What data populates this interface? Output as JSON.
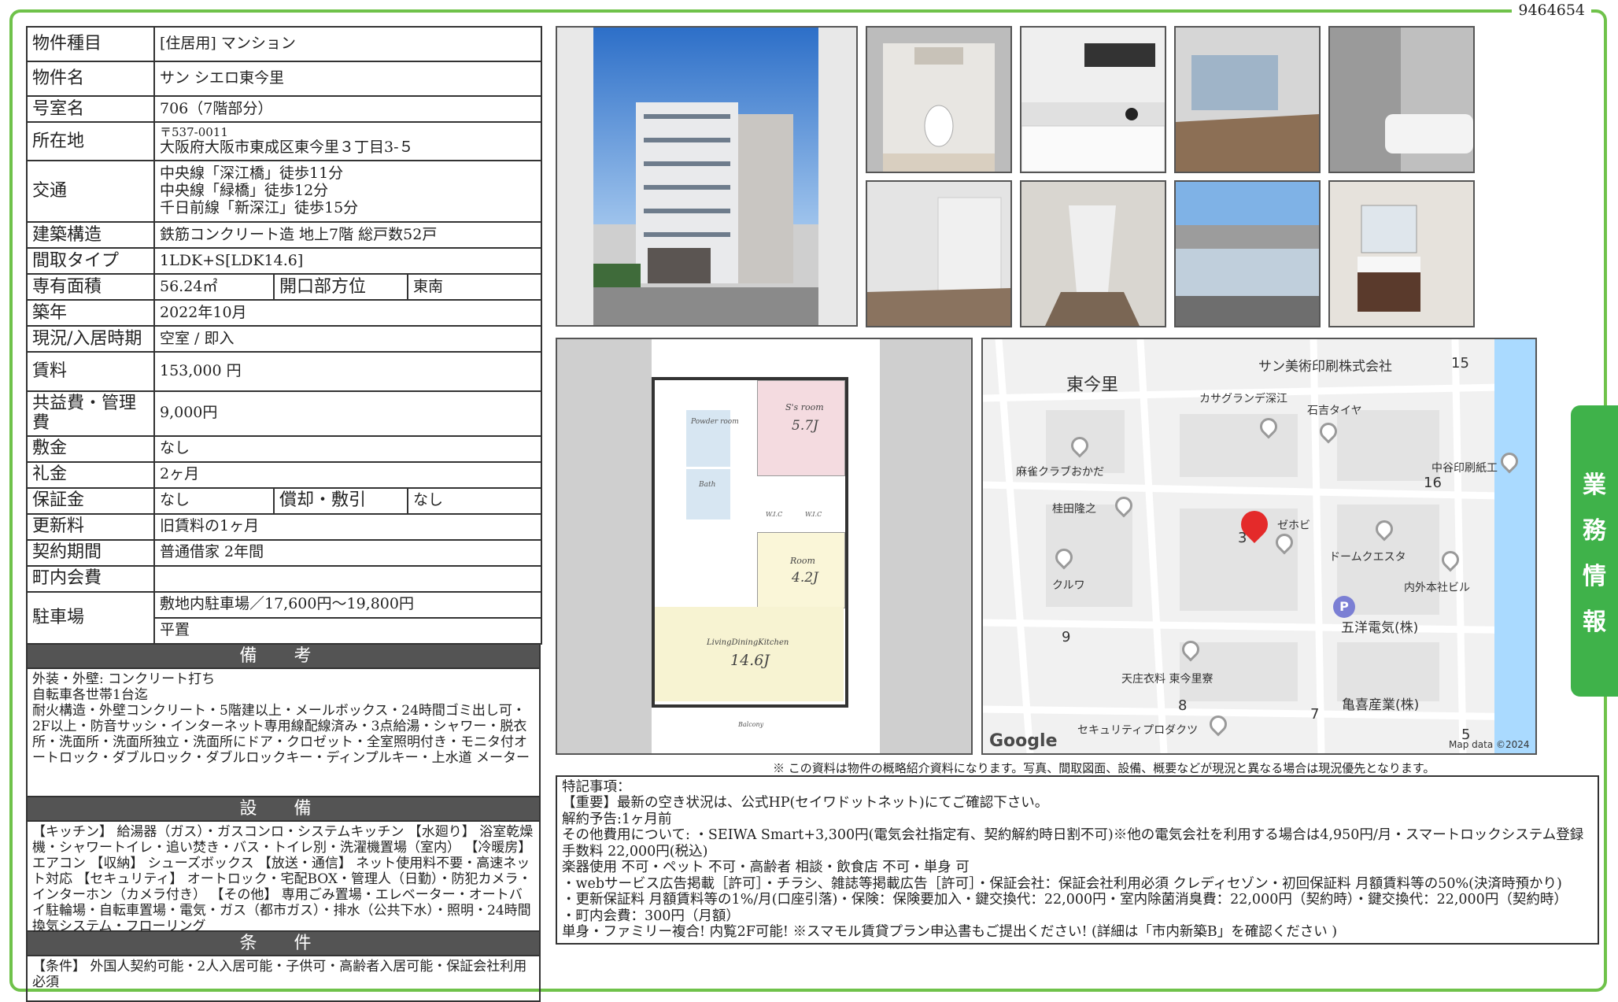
{
  "doc_no": "9464654",
  "spec": {
    "type_label": "物件種目",
    "type_value": "[住居用] マンション",
    "name_label": "物件名",
    "name_value": "サン シエロ東今里",
    "room_label": "号室名",
    "room_value": "706（7階部分）",
    "addr_label": "所在地",
    "zip": "〒537-0011",
    "addr_value": "大阪府大阪市東成区東今里３丁目3-５",
    "access_label": "交通",
    "access1": "中央線「深江橋」徒歩11分",
    "access2": "中央線「緑橋」徒歩12分",
    "access3": "千日前線「新深江」徒歩15分",
    "structure_label": "建築構造",
    "structure_value": "鉄筋コンクリート造 地上7階 総戸数52戸",
    "layout_label": "間取タイプ",
    "layout_value": "1LDK+S[LDK14.6]",
    "area_label": "専有面積",
    "area_value": "56.24㎡",
    "facing_label": "開口部方位",
    "facing_value": "東南",
    "built_label": "築年",
    "built_value": "2022年10月",
    "status_label": "現況/入居時期",
    "status_value": "空室 / 即入",
    "rent_label": "賃料",
    "rent_value": "153,000 円",
    "fee_label": "共益費・管理費",
    "fee_value": "9,000円",
    "deposit_label": "敷金",
    "deposit_value": "なし",
    "key_label": "礼金",
    "key_value": "2ヶ月",
    "guarantee_label": "保証金",
    "guarantee_value": "なし",
    "amort_label": "償却・敷引",
    "amort_value": "なし",
    "renew_label": "更新料",
    "renew_value": "旧賃料の1ヶ月",
    "contract_label": "契約期間",
    "contract_value": "普通借家 2年間",
    "town_label": "町内会費",
    "town_value": "",
    "parking_label": "駐車場",
    "parking1": "敷地内駐車場／17,600円～19,800円",
    "parking2": "平置"
  },
  "sections": {
    "remarks_title": "備 考",
    "remarks_text": "外装・外壁: コンクリート打ち\n自転車各世帯1台迄\n耐火構造・外壁コンクリート・5階建以上・メールボックス・24時間ゴミ出し可・2F以上・防音サッシ・インターネット専用線配線済み・3点給湯・シャワー・脱衣所・洗面所・洗面所独立・洗面所にドア・クロゼット・全室照明付き・モニタ付オートロック・ダブルロック・ダブルロックキー・ディンプルキー・上水道 メーター",
    "equip_title": "設 備",
    "equip_text": "【キッチン】 給湯器（ガス）・ガスコンロ・システムキッチン 【水廻り】 浴室乾燥機・シャワートイレ・追い焚き・バス・トイレ別・洗濯機置場（室内） 【冷暖房】 エアコン 【収納】 シューズボックス 【放送・通信】 ネット使用料不要・高速ネット対応 【セキュリティ】 オートロック・宅配BOX・管理人（日勤）・防犯カメラ・インターホン（カメラ付き） 【その他】 専用ごみ置場・エレベーター・オートバイ駐輪場・自転車置場・電気・ガス（都市ガス）・排水（公共下水）・照明・24時間換気システム・フローリング",
    "cond_title": "条 件",
    "cond_text": "【条件】 外国人契約可能・2人入居可能・子供可・高齢者入居可能・保証会社利用必須"
  },
  "floorplan": {
    "powder": "Powder room",
    "bath": "Bath",
    "sroom": "S's room",
    "sroom_size": "5.7J",
    "wic1": "W.I.C",
    "wic2": "W.I.C",
    "room": "Room",
    "room_size": "4.2J",
    "ldk": "LivingDiningKitchen",
    "ldk_size": "14.6J",
    "balcony": "Balcony"
  },
  "map": {
    "area": "東今里",
    "labels": [
      "サン美術印刷株式会社",
      "カサグランデ深江",
      "石吉タイヤ",
      "麻雀クラブおかだ",
      "中谷印刷紙工",
      "桂田隆之",
      "ゼホビ",
      "ドームクエスタ",
      "クルワ",
      "内外本社ビル",
      "五洋電気(株)",
      "天庄衣料 東今里寮",
      "亀喜産業(株)",
      "セキュリティプロダクツ"
    ],
    "numbers": [
      "15",
      "16",
      "3",
      "9",
      "8",
      "7",
      "5"
    ],
    "google": "Google",
    "copyright": "Map data ©2024"
  },
  "side_tab": [
    "業",
    "務",
    "情",
    "報"
  ],
  "note": "※ この資料は物件の概略紹介資料になります。写真、間取図面、設備、概要などが現況と異なる場合は現況優先となります。",
  "special": [
    "特記事項：",
    "【重要】最新の空き状況は、公式HP(セイワドットネット)にてご確認下さい。",
    "解約予告:1ヶ月前",
    "その他費用について: ・SEIWA Smart+3,300円(電気会社指定有、契約解約時日割不可)※他の電気会社を利用する場合は4,950円/月・スマートロックシステム登録手数料 22,000円(税込)",
    "楽器使用 不可・ペット 不可・高齢者 相談・飲食店 不可・単身 可",
    "・webサービス広告掲載［許可］・チラシ、雑誌等掲載広告［許可］・保証会社：保証会社利用必須 クレディセゾン・初回保証料 月額賃料等の50%(決済時預かり)",
    "・更新保証料 月額賃料等の1%/月(口座引落)・保険：保険要加入・鍵交換代：22,000円・室内除菌消臭費：22,000円（契約時）・鍵交換代：22,000円（契約時）",
    "・町内会費：300円（月額）",
    "単身・ファミリー複合! 内覧2F可能! ※スマモル賃貸プラン申込書もご提出ください! (詳細は「市内新築B」を確認ください )"
  ]
}
